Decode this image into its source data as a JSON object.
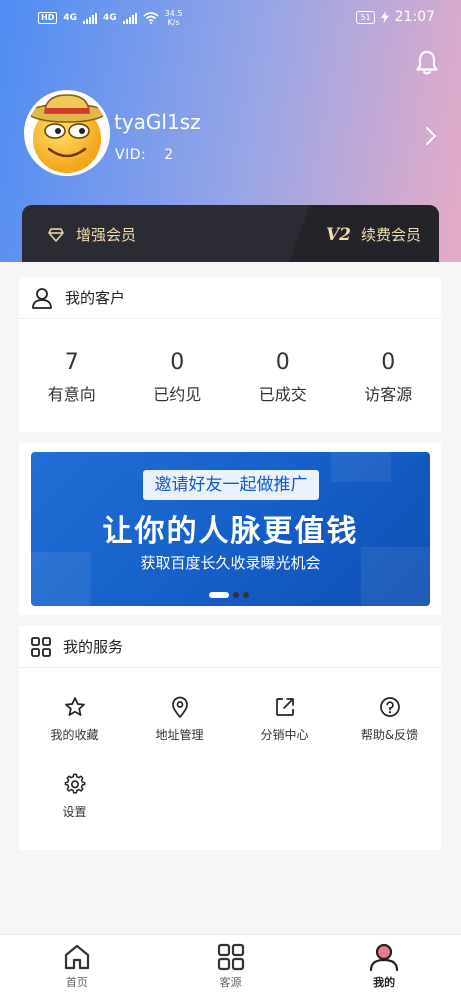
{
  "status_bar": {
    "network_speed": "34.5",
    "network_unit": "K/s",
    "battery": "51",
    "time": "21:07",
    "signal_labels": [
      "4G",
      "4G"
    ]
  },
  "profile": {
    "username": "tyaGl1sz",
    "vid_label": "VID:",
    "vid_value": "2"
  },
  "member_bar": {
    "left_label": "增强会员",
    "level": "V2",
    "right_label": "续费会员"
  },
  "customers": {
    "title": "我的客户",
    "stats": [
      {
        "value": "7",
        "label": "有意向"
      },
      {
        "value": "0",
        "label": "已约见"
      },
      {
        "value": "0",
        "label": "已成交"
      },
      {
        "value": "0",
        "label": "访客源"
      }
    ]
  },
  "banner": {
    "subtitle": "邀请好友一起做推广",
    "headline": "让你的人脉更值钱",
    "description": "获取百度长久收录曝光机会"
  },
  "services": {
    "title": "我的服务",
    "items": [
      {
        "label": "我的收藏",
        "icon": "star-icon"
      },
      {
        "label": "地址管理",
        "icon": "location-icon"
      },
      {
        "label": "分销中心",
        "icon": "share-icon"
      },
      {
        "label": "帮助&反馈",
        "icon": "help-icon"
      },
      {
        "label": "设置",
        "icon": "settings-icon"
      }
    ]
  },
  "tabbar": {
    "tabs": [
      {
        "label": "首页",
        "icon": "home-icon"
      },
      {
        "label": "客源",
        "icon": "grid-icon"
      },
      {
        "label": "我的",
        "icon": "user-icon",
        "active": true
      }
    ]
  },
  "colors": {
    "gold": "#f2dcae",
    "member_bar": "#2b2b33",
    "banner_blue": "#1560c9"
  }
}
